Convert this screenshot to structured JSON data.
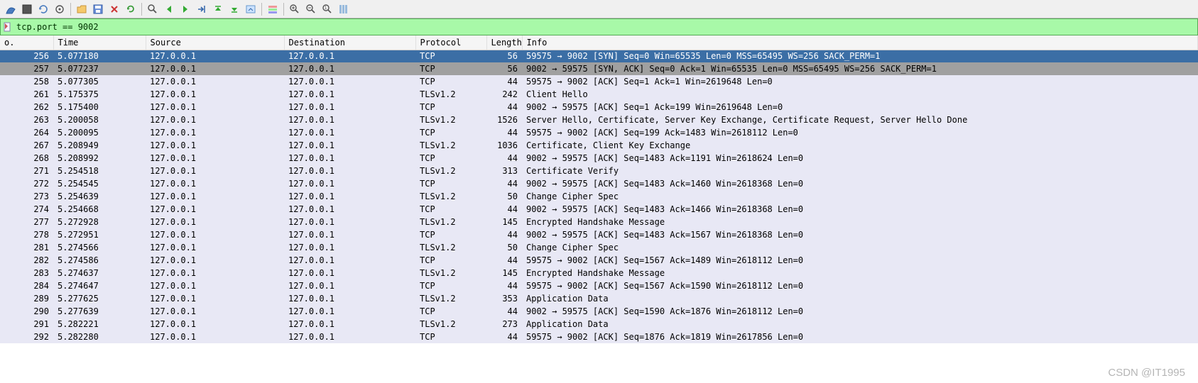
{
  "filter": {
    "value": "tcp.port == 9002"
  },
  "columns": {
    "no": "o.",
    "time": "Time",
    "source": "Source",
    "destination": "Destination",
    "protocol": "Protocol",
    "length": "Length",
    "info": "Info"
  },
  "packets": [
    {
      "no": 256,
      "time": "5.077180",
      "src": "127.0.0.1",
      "dst": "127.0.0.1",
      "proto": "TCP",
      "len": 56,
      "info": "59575 → 9002 [SYN] Seq=0 Win=65535 Len=0 MSS=65495 WS=256 SACK_PERM=1",
      "cls": "sel0"
    },
    {
      "no": 257,
      "time": "5.077237",
      "src": "127.0.0.1",
      "dst": "127.0.0.1",
      "proto": "TCP",
      "len": 56,
      "info": "9002 → 59575 [SYN, ACK] Seq=0 Ack=1 Win=65535 Len=0 MSS=65495 WS=256 SACK_PERM=1",
      "cls": "sel1"
    },
    {
      "no": 258,
      "time": "5.077305",
      "src": "127.0.0.1",
      "dst": "127.0.0.1",
      "proto": "TCP",
      "len": 44,
      "info": "59575 → 9002 [ACK] Seq=1 Ack=1 Win=2619648 Len=0",
      "cls": ""
    },
    {
      "no": 261,
      "time": "5.175375",
      "src": "127.0.0.1",
      "dst": "127.0.0.1",
      "proto": "TLSv1.2",
      "len": 242,
      "info": "Client Hello",
      "cls": ""
    },
    {
      "no": 262,
      "time": "5.175400",
      "src": "127.0.0.1",
      "dst": "127.0.0.1",
      "proto": "TCP",
      "len": 44,
      "info": "9002 → 59575 [ACK] Seq=1 Ack=199 Win=2619648 Len=0",
      "cls": ""
    },
    {
      "no": 263,
      "time": "5.200058",
      "src": "127.0.0.1",
      "dst": "127.0.0.1",
      "proto": "TLSv1.2",
      "len": 1526,
      "info": "Server Hello, Certificate, Server Key Exchange, Certificate Request, Server Hello Done",
      "cls": ""
    },
    {
      "no": 264,
      "time": "5.200095",
      "src": "127.0.0.1",
      "dst": "127.0.0.1",
      "proto": "TCP",
      "len": 44,
      "info": "59575 → 9002 [ACK] Seq=199 Ack=1483 Win=2618112 Len=0",
      "cls": ""
    },
    {
      "no": 267,
      "time": "5.208949",
      "src": "127.0.0.1",
      "dst": "127.0.0.1",
      "proto": "TLSv1.2",
      "len": 1036,
      "info": "Certificate, Client Key Exchange",
      "cls": ""
    },
    {
      "no": 268,
      "time": "5.208992",
      "src": "127.0.0.1",
      "dst": "127.0.0.1",
      "proto": "TCP",
      "len": 44,
      "info": "9002 → 59575 [ACK] Seq=1483 Ack=1191 Win=2618624 Len=0",
      "cls": ""
    },
    {
      "no": 271,
      "time": "5.254518",
      "src": "127.0.0.1",
      "dst": "127.0.0.1",
      "proto": "TLSv1.2",
      "len": 313,
      "info": "Certificate Verify",
      "cls": ""
    },
    {
      "no": 272,
      "time": "5.254545",
      "src": "127.0.0.1",
      "dst": "127.0.0.1",
      "proto": "TCP",
      "len": 44,
      "info": "9002 → 59575 [ACK] Seq=1483 Ack=1460 Win=2618368 Len=0",
      "cls": ""
    },
    {
      "no": 273,
      "time": "5.254639",
      "src": "127.0.0.1",
      "dst": "127.0.0.1",
      "proto": "TLSv1.2",
      "len": 50,
      "info": "Change Cipher Spec",
      "cls": ""
    },
    {
      "no": 274,
      "time": "5.254668",
      "src": "127.0.0.1",
      "dst": "127.0.0.1",
      "proto": "TCP",
      "len": 44,
      "info": "9002 → 59575 [ACK] Seq=1483 Ack=1466 Win=2618368 Len=0",
      "cls": ""
    },
    {
      "no": 277,
      "time": "5.272928",
      "src": "127.0.0.1",
      "dst": "127.0.0.1",
      "proto": "TLSv1.2",
      "len": 145,
      "info": "Encrypted Handshake Message",
      "cls": ""
    },
    {
      "no": 278,
      "time": "5.272951",
      "src": "127.0.0.1",
      "dst": "127.0.0.1",
      "proto": "TCP",
      "len": 44,
      "info": "9002 → 59575 [ACK] Seq=1483 Ack=1567 Win=2618368 Len=0",
      "cls": ""
    },
    {
      "no": 281,
      "time": "5.274566",
      "src": "127.0.0.1",
      "dst": "127.0.0.1",
      "proto": "TLSv1.2",
      "len": 50,
      "info": "Change Cipher Spec",
      "cls": ""
    },
    {
      "no": 282,
      "time": "5.274586",
      "src": "127.0.0.1",
      "dst": "127.0.0.1",
      "proto": "TCP",
      "len": 44,
      "info": "59575 → 9002 [ACK] Seq=1567 Ack=1489 Win=2618112 Len=0",
      "cls": ""
    },
    {
      "no": 283,
      "time": "5.274637",
      "src": "127.0.0.1",
      "dst": "127.0.0.1",
      "proto": "TLSv1.2",
      "len": 145,
      "info": "Encrypted Handshake Message",
      "cls": ""
    },
    {
      "no": 284,
      "time": "5.274647",
      "src": "127.0.0.1",
      "dst": "127.0.0.1",
      "proto": "TCP",
      "len": 44,
      "info": "59575 → 9002 [ACK] Seq=1567 Ack=1590 Win=2618112 Len=0",
      "cls": ""
    },
    {
      "no": 289,
      "time": "5.277625",
      "src": "127.0.0.1",
      "dst": "127.0.0.1",
      "proto": "TLSv1.2",
      "len": 353,
      "info": "Application Data",
      "cls": ""
    },
    {
      "no": 290,
      "time": "5.277639",
      "src": "127.0.0.1",
      "dst": "127.0.0.1",
      "proto": "TCP",
      "len": 44,
      "info": "9002 → 59575 [ACK] Seq=1590 Ack=1876 Win=2618112 Len=0",
      "cls": ""
    },
    {
      "no": 291,
      "time": "5.282221",
      "src": "127.0.0.1",
      "dst": "127.0.0.1",
      "proto": "TLSv1.2",
      "len": 273,
      "info": "Application Data",
      "cls": ""
    },
    {
      "no": 292,
      "time": "5.282280",
      "src": "127.0.0.1",
      "dst": "127.0.0.1",
      "proto": "TCP",
      "len": 44,
      "info": "59575 → 9002 [ACK] Seq=1876 Ack=1819 Win=2617856 Len=0",
      "cls": ""
    }
  ],
  "watermark": "CSDN @IT1995",
  "toolbar_icons": [
    "shark-fin",
    "stop",
    "restart",
    "options",
    "folder",
    "save",
    "close",
    "reload",
    "find",
    "prev",
    "next",
    "goto",
    "top",
    "bottom",
    "autoscroll",
    "colorize",
    "zoom-in",
    "zoom-out",
    "zoom-reset",
    "columns"
  ]
}
